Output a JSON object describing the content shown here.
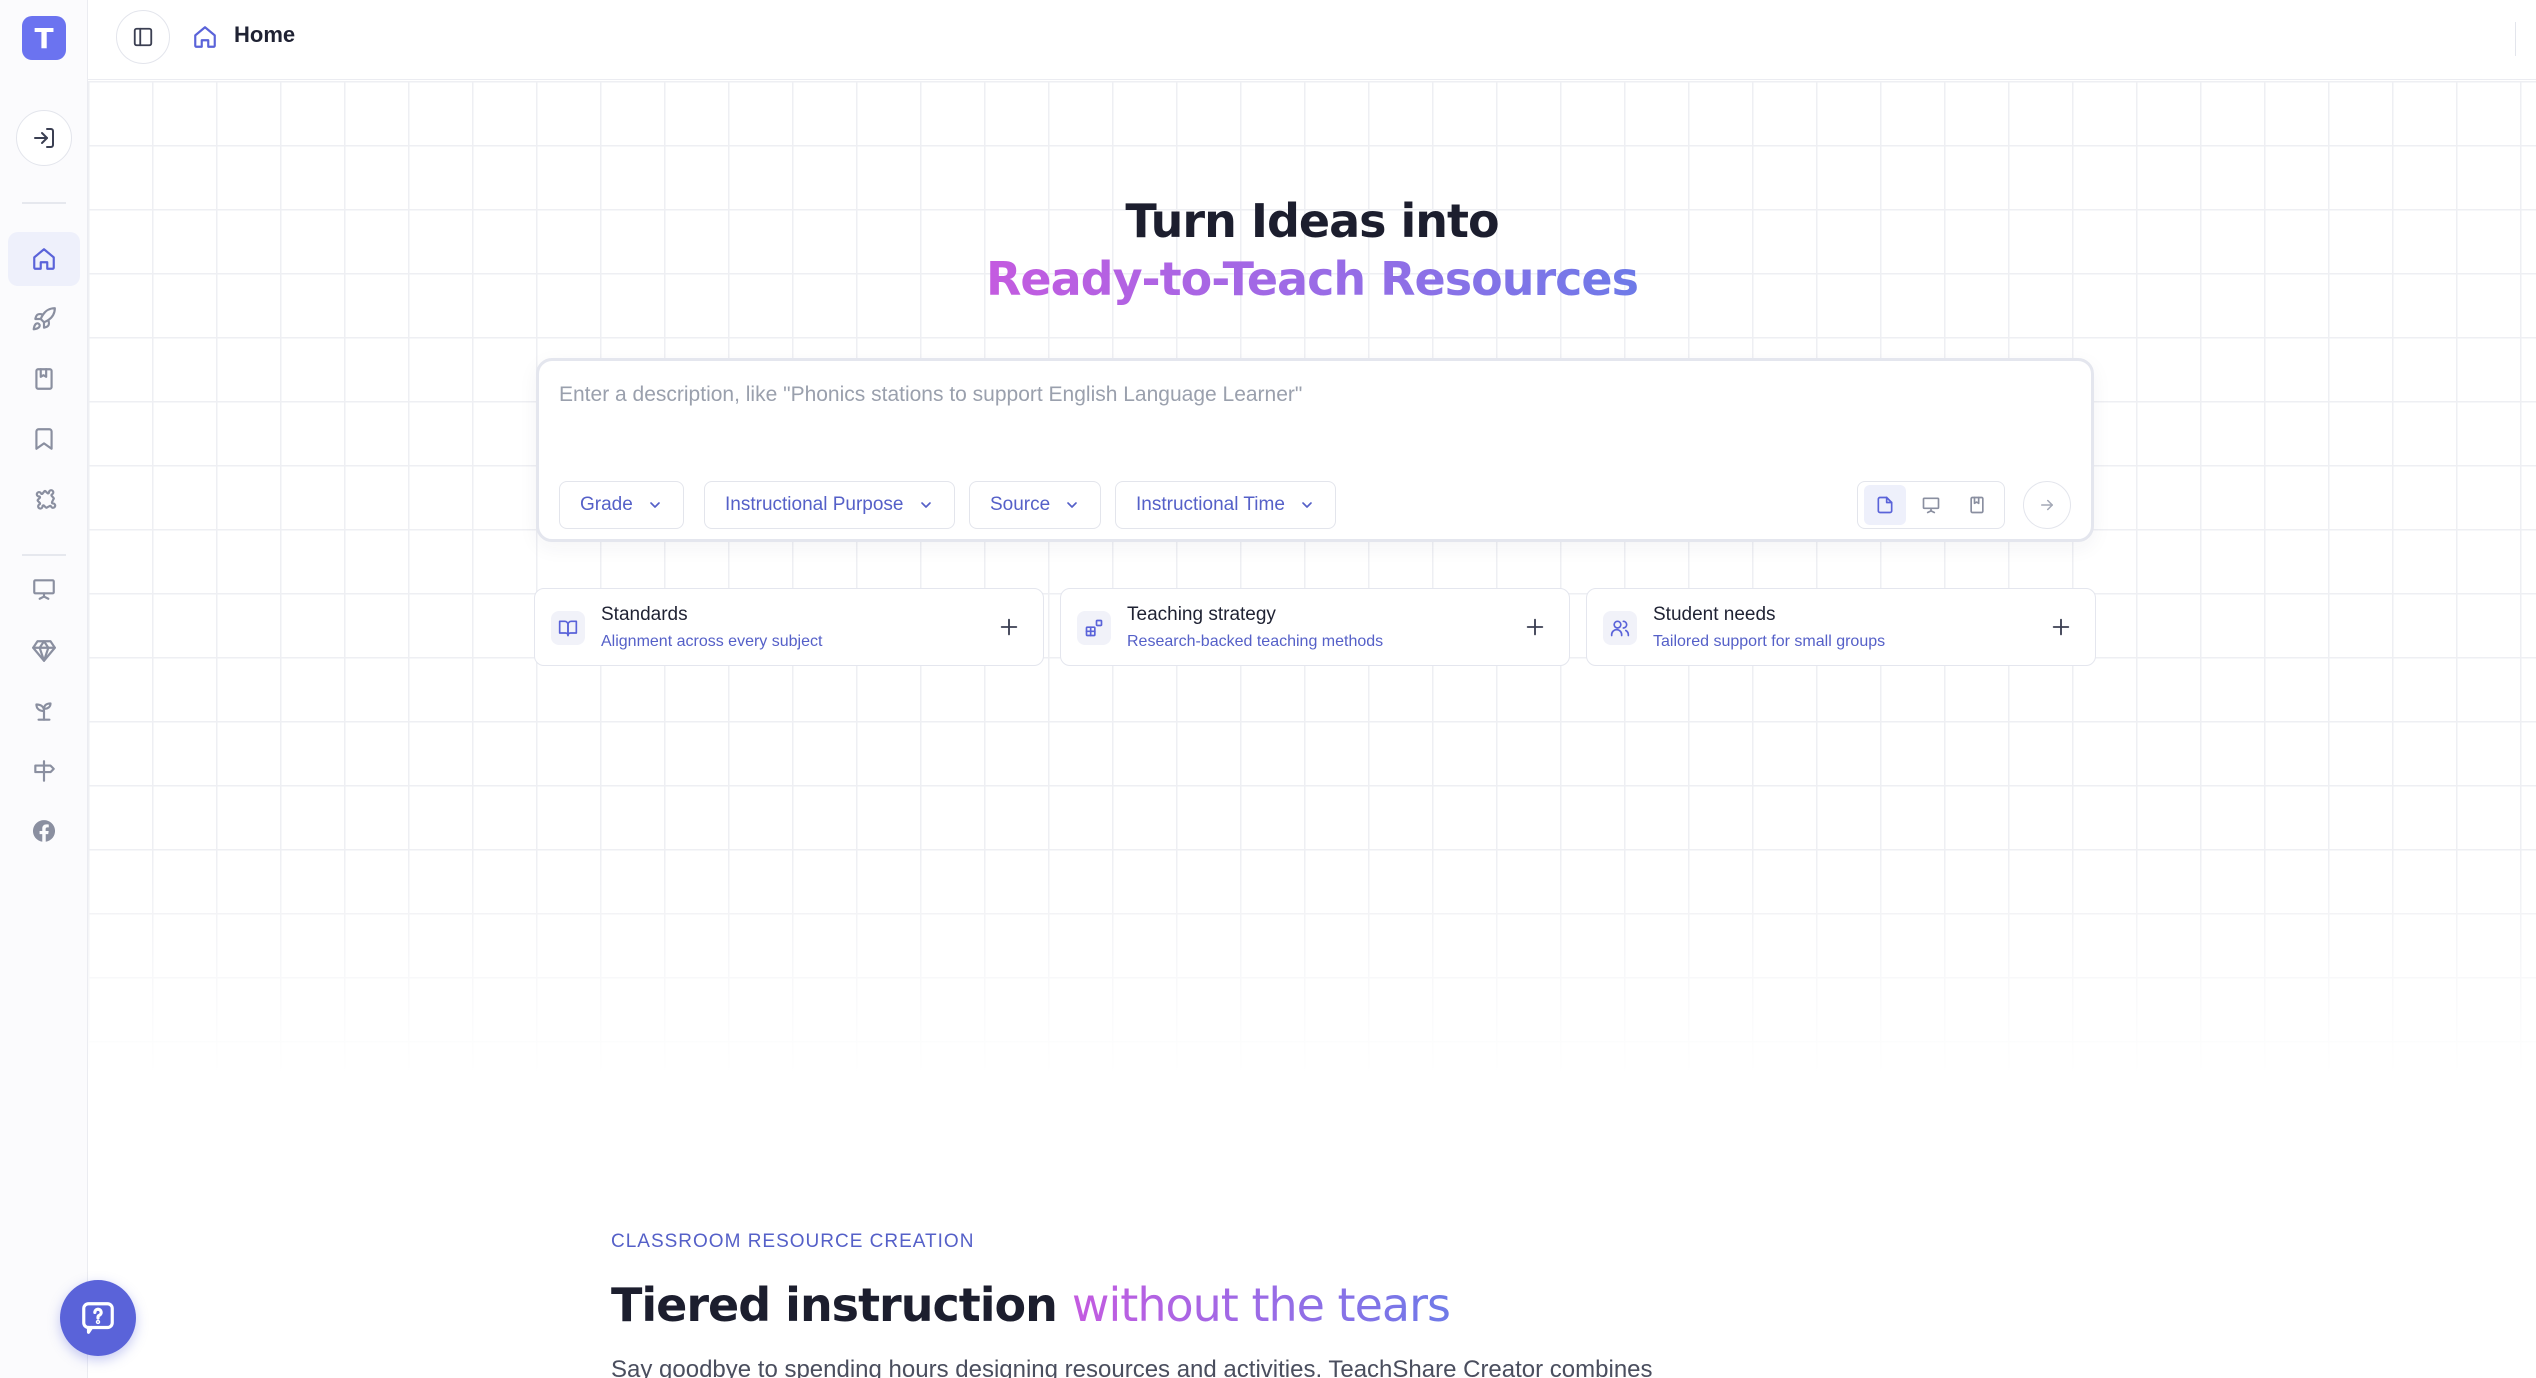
{
  "app": {
    "logo_letter": "T"
  },
  "header": {
    "breadcrumb": "Home"
  },
  "hero": {
    "line1": "Turn Ideas into",
    "line2": "Ready-to-Teach Resources"
  },
  "prompt": {
    "placeholder": "Enter a description, like \"Phonics stations to support English Language Learner\"",
    "value": ""
  },
  "filters": [
    {
      "label": "Grade"
    },
    {
      "label": "Instructional Purpose"
    },
    {
      "label": "Source"
    },
    {
      "label": "Instructional Time"
    }
  ],
  "features": [
    {
      "title": "Standards",
      "subtitle": "Alignment across every subject",
      "icon": "open-book-icon"
    },
    {
      "title": "Teaching strategy",
      "subtitle": "Research-backed teaching methods",
      "icon": "blocks-icon"
    },
    {
      "title": "Student needs",
      "subtitle": "Tailored support for small groups",
      "icon": "users-icon"
    }
  ],
  "section": {
    "eyebrow": "CLASSROOM RESOURCE CREATION",
    "title_plain": "Tiered instruction ",
    "title_accent": "without the tears",
    "body": "Say goodbye to spending hours designing resources and activities. TeachShare Creator combines"
  },
  "colors": {
    "accent": "#5a63d9",
    "logo": "#6b73f0",
    "gradient_start": "#c45be0",
    "gradient_end": "#6e7ae8"
  }
}
